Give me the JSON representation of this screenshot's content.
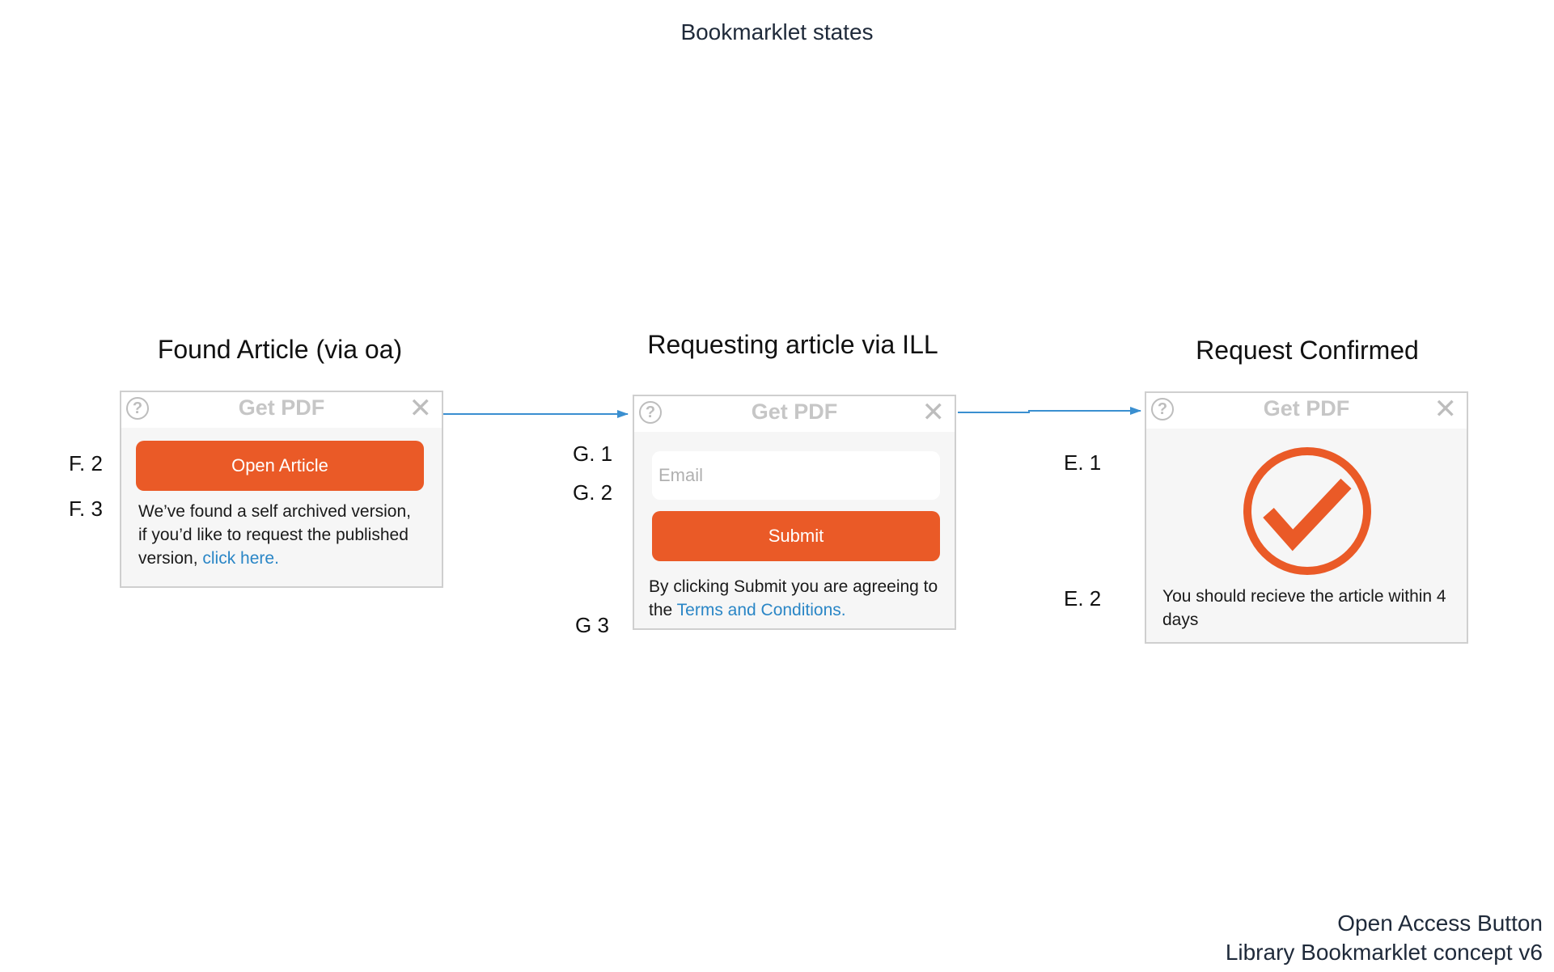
{
  "page_title": "Bookmarklet states",
  "footer": {
    "line1": "Open Access Button",
    "line2": "Library Bookmarklet concept v6"
  },
  "states": {
    "found": {
      "title": "Found Article (via oa)",
      "widget_title": "Get PDF",
      "button": "Open Article",
      "text_before": "We’ve found a self archived version, if you’d like to request the published version, ",
      "link": "click here.",
      "labels": [
        "F. 2",
        "F. 3"
      ]
    },
    "requesting": {
      "title": "Requesting article via ILL",
      "widget_title": "Get PDF",
      "email_placeholder": "Email",
      "button": "Submit",
      "text_before": "By clicking Submit you are agreeing to the ",
      "link": "Terms and Conditions.",
      "labels": [
        "G. 1",
        "G. 2",
        "G 3"
      ]
    },
    "confirmed": {
      "title": "Request Confirmed",
      "widget_title": "Get PDF",
      "text": "You should recieve the article within 4 days",
      "labels": [
        "E. 1",
        "E. 2"
      ]
    }
  },
  "icons": {
    "help": "question-circle-icon",
    "close": "close-icon",
    "check": "checkmark-circle-icon"
  },
  "colors": {
    "accent": "#ea5a27",
    "link": "#2a86c6",
    "arrow": "#3a8fd0",
    "widget_bg": "#f6f6f6",
    "widget_border": "#cfcfcf"
  },
  "glyphs": {
    "help": "?",
    "close": "✕"
  }
}
